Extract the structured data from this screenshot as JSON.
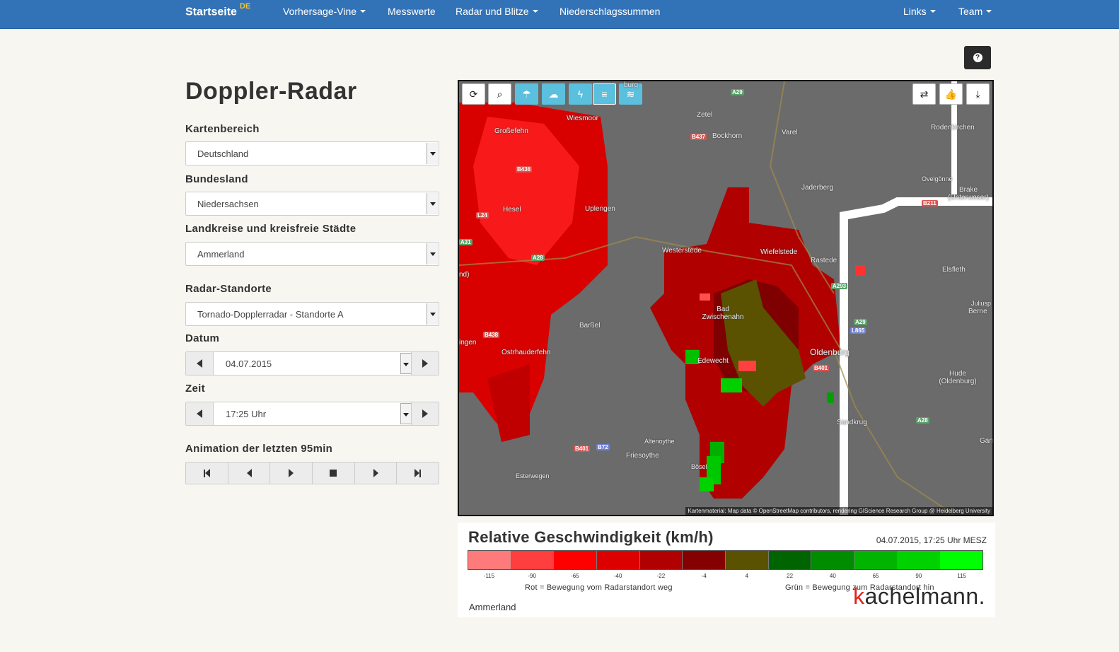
{
  "nav": {
    "brand": "Startseite",
    "brand_sup": "DE",
    "items": [
      {
        "label": "Vorhersage-Vine",
        "dropdown": true
      },
      {
        "label": "Messwerte",
        "dropdown": false
      },
      {
        "label": "Radar und Blitze",
        "dropdown": true
      },
      {
        "label": "Niederschlagssummen",
        "dropdown": false
      }
    ],
    "right_items": [
      {
        "label": "Links",
        "dropdown": true
      },
      {
        "label": "Team",
        "dropdown": true
      }
    ]
  },
  "help_icon": "question-circle-icon",
  "page_title": "Doppler-Radar",
  "form": {
    "kartenbereich": {
      "label": "Kartenbereich",
      "value": "Deutschland"
    },
    "bundesland": {
      "label": "Bundesland",
      "value": "Niedersachsen"
    },
    "landkreis": {
      "label": "Landkreise und kreisfreie Städte",
      "value": "Ammerland"
    },
    "radar": {
      "label": "Radar-Standorte",
      "value": "Tornado-Dopplerradar - Standorte A"
    },
    "datum": {
      "label": "Datum",
      "value": "04.07.2015"
    },
    "zeit": {
      "label": "Zeit",
      "value": "17:25 Uhr"
    },
    "animation": {
      "label": "Animation der letzten 95min"
    }
  },
  "map": {
    "toolbar_left": [
      "refresh-icon",
      "zoom-icon",
      "umbrella-icon",
      "cloud-rain-icon",
      "lightning-icon",
      "wind-radar-icon",
      "wind-icon"
    ],
    "toolbar_right": [
      "retweet-icon",
      "thumbs-up-icon",
      "download-icon"
    ],
    "attribution": "Kartenmaterial: Map data © OpenStreetMap contributors, rendering GIScience Research Group @ Heidelberg University",
    "cities": [
      "Großefehn",
      "Wiesmoor",
      "Zetel",
      "Bockhorn",
      "Varel",
      "Rodenkirchen",
      "Hesel",
      "Uplengen",
      "Jaderberg",
      "Ovelgönne",
      "Brake (Unterweser)",
      "Westerstede",
      "Wiefelstede",
      "Rastede",
      "Elsfleth",
      "Bad Zwischenahn",
      "Barßel",
      "Oldenburg",
      "Ostrhauderfehn",
      "Edewecht",
      "Sandkrug",
      "Hude (Oldenburg)",
      "Altenoythe",
      "Friesoythe",
      "Esterwegen",
      "Bösel",
      "Berne",
      "Juliusp",
      "Gan",
      "ingen",
      "nd)",
      "burg"
    ],
    "roads": [
      "A29",
      "B437",
      "B436",
      "L24",
      "A28",
      "A31",
      "B438",
      "A293",
      "A29",
      "L865",
      "B401",
      "B211",
      "A28",
      "B401",
      "B72"
    ]
  },
  "legend": {
    "title": "Relative Geschwindigkeit (km/h)",
    "date": "04.07.2015, 17:25 Uhr MESZ",
    "colors": [
      "#ff7b7b",
      "#ff3f3f",
      "#ff0000",
      "#dd0000",
      "#b00000",
      "#850000",
      "#5a5200",
      "#006400",
      "#008c00",
      "#00b400",
      "#00d200",
      "#00ff00"
    ],
    "ticks": [
      "-115",
      "-90",
      "-65",
      "-40",
      "-22",
      "-4",
      "4",
      "22",
      "40",
      "65",
      "90",
      "115"
    ],
    "note_red": "Rot = Bewegung vom Radarstandort weg",
    "note_green": "Grün = Bewegung zum Radarstandort hin",
    "area": "Ammerland",
    "logo_k": "k",
    "logo_rest": "achelmann."
  }
}
